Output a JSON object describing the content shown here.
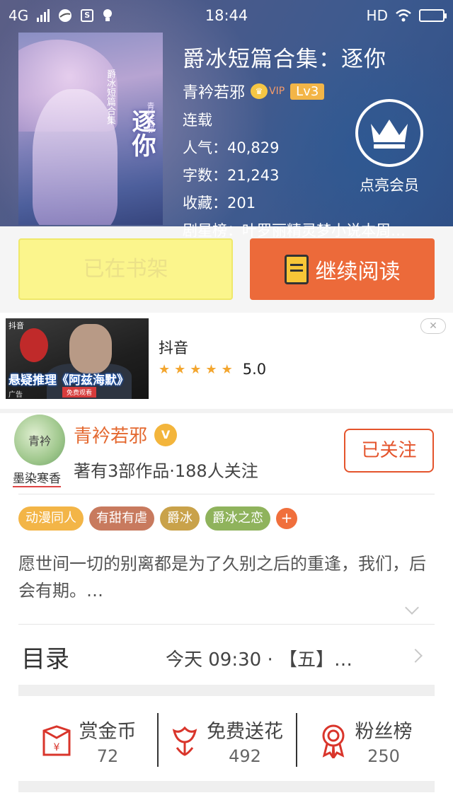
{
  "status_bar": {
    "network": "4G",
    "time": "18:44",
    "hd": "HD"
  },
  "book": {
    "title": "爵冰短篇合集：逐你",
    "author": "青衿若邪",
    "vip_label": "VIP",
    "level": "Lv3",
    "status": "连载",
    "popularity": "人气：40,829",
    "word_count": "字数：21,243",
    "favorites": "收藏：201",
    "rank": "剧星榜：叶罗丽精灵梦小说本周…"
  },
  "cover": {
    "title": "逐你",
    "subtitle": "爵冰短篇合集",
    "author": "青衿若邪"
  },
  "member": {
    "label": "点亮会员"
  },
  "actions": {
    "shelf_label": "已在书架",
    "read_label": "继续阅读"
  },
  "ad": {
    "app_name": "抖音",
    "rating": "5.0",
    "stars": 5,
    "thumb_logo": "抖音",
    "thumb_banner": "悬疑推理《阿兹海默》",
    "thumb_free": "免费观看",
    "thumb_tag": "广告",
    "close": "✕"
  },
  "author_card": {
    "avatar_text": "青衿",
    "seal_text": "墨染寒香",
    "name": "青衿若邪",
    "verified": "V",
    "meta": "著有3部作品·188人关注",
    "follow_label": "已关注"
  },
  "tags": [
    {
      "label": "动漫同人",
      "color": "#f3b547"
    },
    {
      "label": "有甜有虐",
      "color": "#c87a5e"
    },
    {
      "label": "爵冰",
      "color": "#c9a24a"
    },
    {
      "label": "爵冰之恋",
      "color": "#8fb35c"
    }
  ],
  "tag_add": "+",
  "description": "愿世间一切的别离都是为了久别之后的重逢，我们，后会有期。…",
  "toc": {
    "title": "目录",
    "latest": "今天 09:30 · 【五】…"
  },
  "stats": [
    {
      "label": "赏金币",
      "value": "72",
      "icon": "red-envelope-icon"
    },
    {
      "label": "免费送花",
      "value": "492",
      "icon": "flower-icon"
    },
    {
      "label": "粉丝榜",
      "value": "250",
      "icon": "medal-icon"
    }
  ],
  "colors": {
    "accent_orange": "#ec6a3a",
    "shelf_yellow": "#fbf58c",
    "icon_red": "#d9352b"
  }
}
